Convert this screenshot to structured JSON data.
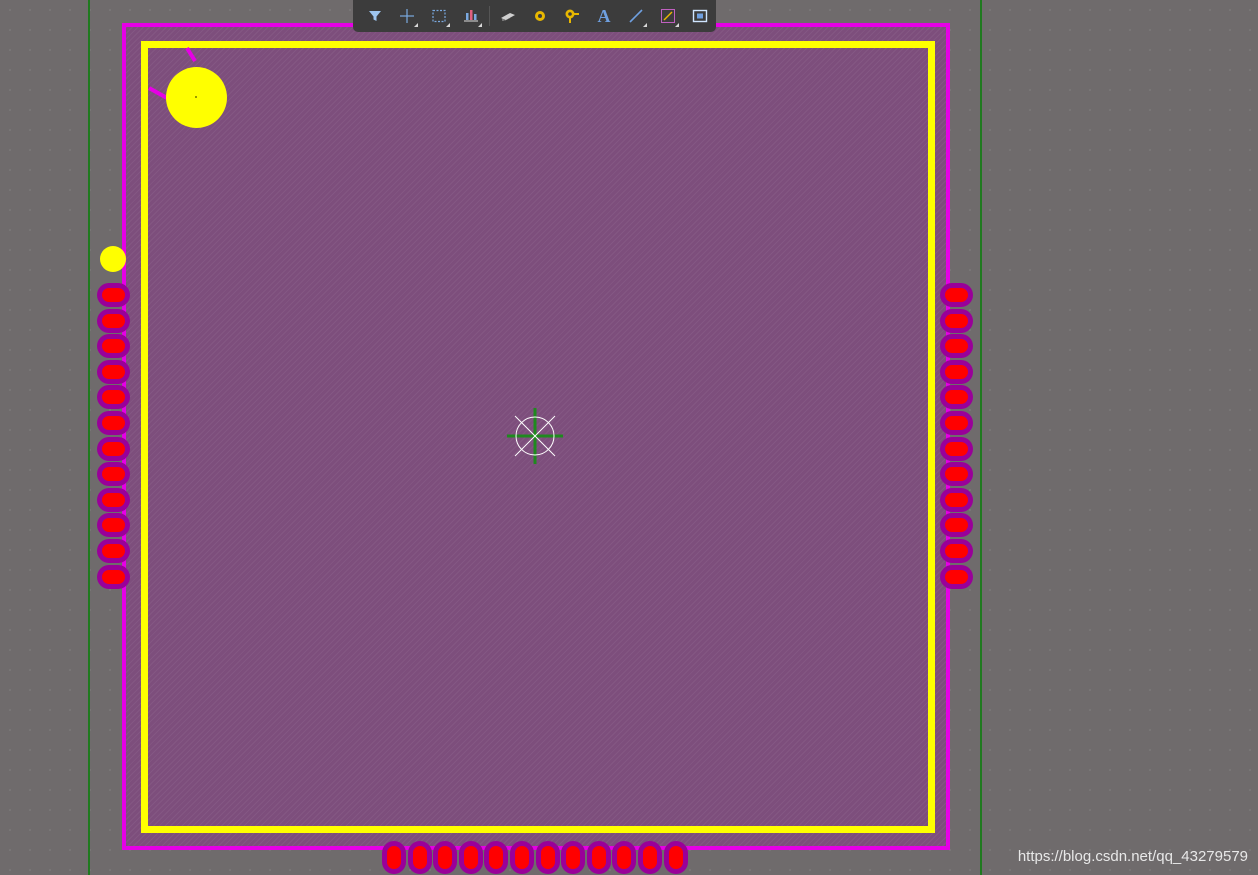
{
  "toolbar": {
    "tools": [
      {
        "name": "filter",
        "icon": "filter-icon"
      },
      {
        "name": "place-component",
        "icon": "crosshair-icon"
      },
      {
        "name": "select",
        "icon": "selection-rectangle-icon"
      },
      {
        "name": "align",
        "icon": "align-icon"
      },
      {
        "name": "component",
        "icon": "component-icon"
      },
      {
        "name": "pad",
        "icon": "pad-icon"
      },
      {
        "name": "via",
        "icon": "via-icon"
      },
      {
        "name": "text",
        "icon": "text-icon",
        "glyph": "A"
      },
      {
        "name": "line",
        "icon": "line-icon"
      },
      {
        "name": "dimension",
        "icon": "dimension-icon"
      },
      {
        "name": "region",
        "icon": "region-icon"
      }
    ]
  },
  "colors": {
    "canvas": "#6f6b6c",
    "board_outline": "#e600e6",
    "board_fill": "#7d4e7c",
    "silkscreen": "#ffff00",
    "pad_mask": "#990099",
    "pad_copper": "#ff0000",
    "grid_line": "#1f7a1f",
    "toolbar_bg": "#3c3c3c"
  },
  "pads": {
    "left_count": 12,
    "right_count": 12,
    "bottom_count": 12
  },
  "watermark": "https://blog.csdn.net/qq_43279579"
}
